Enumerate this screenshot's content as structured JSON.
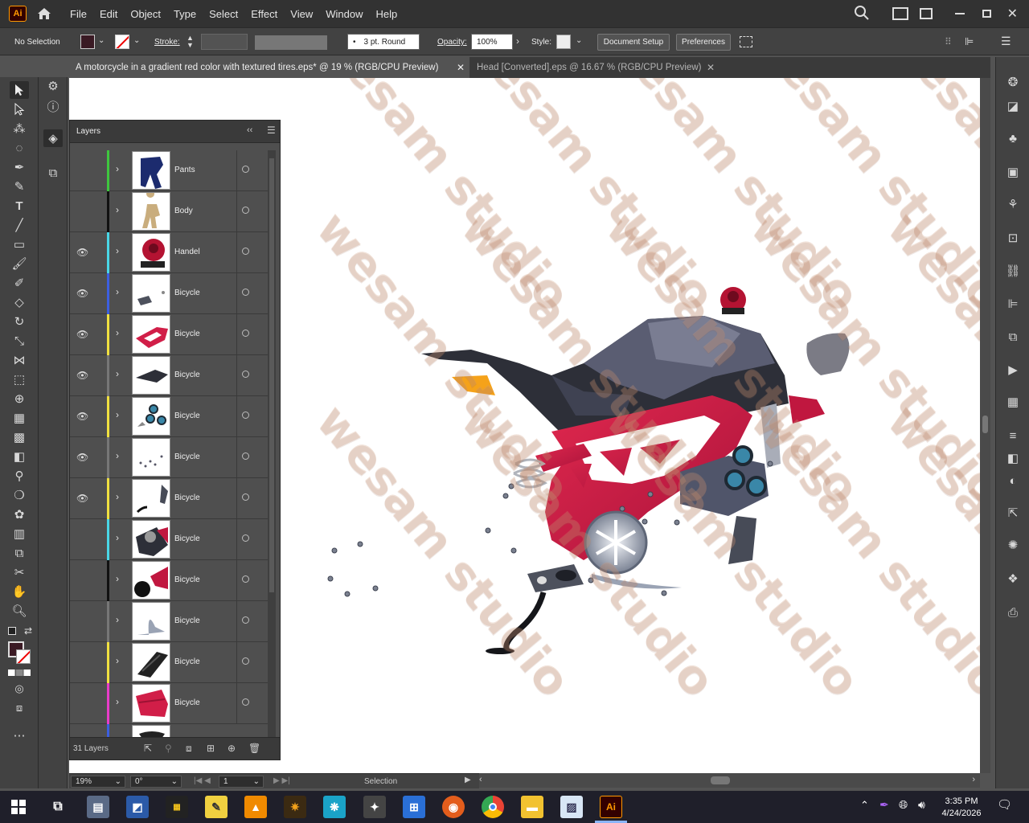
{
  "app": {
    "logo": "Ai"
  },
  "menu": [
    "File",
    "Edit",
    "Object",
    "Type",
    "Select",
    "Effect",
    "View",
    "Window",
    "Help"
  ],
  "control": {
    "selection": "No Selection",
    "stroke_label": "Stroke:",
    "brush": "3 pt. Round",
    "opacity_label": "Opacity:",
    "opacity_value": "100%",
    "style_label": "Style:",
    "document_setup": "Document Setup",
    "preferences": "Preferences"
  },
  "tabs": [
    {
      "label": "A motorcycle in a gradient red color with textured tires.eps* @ 19 % (RGB/CPU Preview)",
      "active": true
    },
    {
      "label": "Head [Converted].eps @ 16.67 % (RGB/CPU Preview)",
      "active": false
    }
  ],
  "layers": {
    "title": "Layers",
    "count_label": "31 Layers",
    "rows": [
      {
        "name": "Pants",
        "color": "#3ec63e",
        "visible": false
      },
      {
        "name": "Body",
        "color": "#111111",
        "visible": false
      },
      {
        "name": "Handel",
        "color": "#49d6e6",
        "visible": true
      },
      {
        "name": "Bicycle",
        "color": "#3c5fe0",
        "visible": true
      },
      {
        "name": "Bicycle",
        "color": "#f0e040",
        "visible": true
      },
      {
        "name": "Bicycle",
        "color": "#777777",
        "visible": true
      },
      {
        "name": "Bicycle",
        "color": "#f0e040",
        "visible": true
      },
      {
        "name": "Bicycle",
        "color": "#777777",
        "visible": true
      },
      {
        "name": "Bicycle",
        "color": "#f0e040",
        "visible": true
      },
      {
        "name": "Bicycle",
        "color": "#49d6e6",
        "visible": false
      },
      {
        "name": "Bicycle",
        "color": "#111111",
        "visible": false
      },
      {
        "name": "Bicycle",
        "color": "#777777",
        "visible": false
      },
      {
        "name": "Bicycle",
        "color": "#f0e040",
        "visible": false
      },
      {
        "name": "Bicycle",
        "color": "#e83cc8",
        "visible": false
      }
    ]
  },
  "status": {
    "zoom": "19%",
    "rotation": "0°",
    "artboard": "1",
    "tool": "Selection"
  },
  "watermark": "wesam studio",
  "taskbar": {
    "time": "3:35 PM",
    "date": "4/24/2026"
  }
}
